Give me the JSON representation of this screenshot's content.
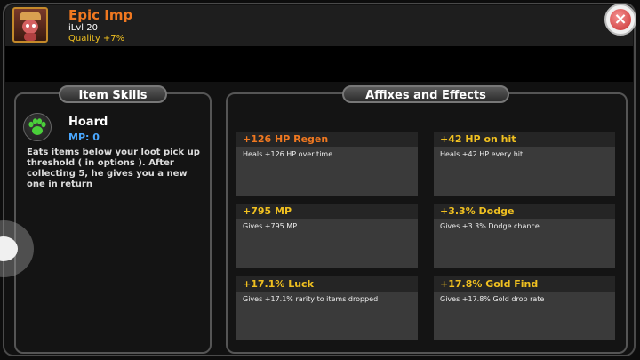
{
  "item": {
    "name": "Epic Imp",
    "ilvl": "iLvl 20",
    "quality": "Quality +7%",
    "name_color": "#f07820",
    "quality_color": "#f0c020",
    "portrait_icon": "imp-portrait-icon"
  },
  "close_glyph": "×",
  "skills_panel": {
    "title": "Item Skills",
    "skill": {
      "name": "Hoard",
      "mp": "MP: 0",
      "icon": "paw-icon",
      "description": "Eats items below your loot pick up threshold ( in options ). After collecting 5, he gives you a new one in return"
    }
  },
  "affixes_panel": {
    "title": "Affixes and Effects",
    "affixes": [
      {
        "title": "+126 HP Regen",
        "desc": "Heals +126 HP over time",
        "color": "#f07820"
      },
      {
        "title": "+42 HP on hit",
        "desc": "Heals +42 HP every hit",
        "color": "#f0c020"
      },
      {
        "title": "+795 MP",
        "desc": "Gives +795 MP",
        "color": "#f0c020"
      },
      {
        "title": "+3.3% Dodge",
        "desc": "Gives +3.3% Dodge chance",
        "color": "#f0c020"
      },
      {
        "title": "+17.1% Luck",
        "desc": "Gives +17.1% rarity to items dropped",
        "color": "#f0c020"
      },
      {
        "title": "+17.8% Gold Find",
        "desc": "Gives +17.8% Gold drop rate",
        "color": "#f0c020"
      }
    ]
  }
}
